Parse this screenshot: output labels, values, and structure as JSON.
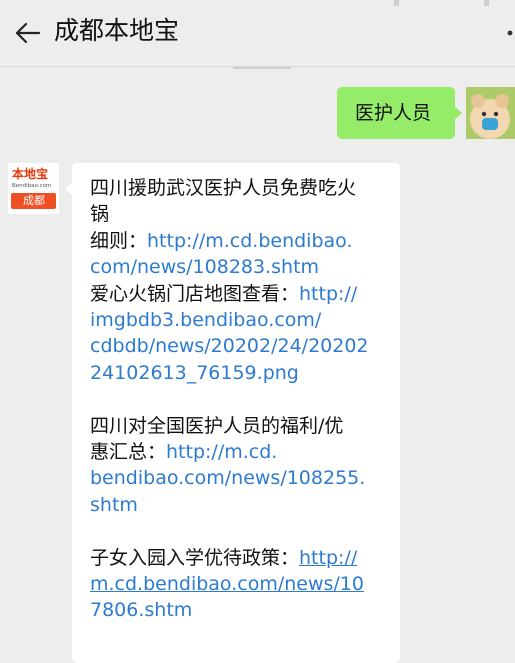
{
  "header": {
    "title": "成都本地宝"
  },
  "outgoing": {
    "text": "医护人员"
  },
  "incoming": {
    "avatar": {
      "logo_top": "本地宝",
      "logo_site": "Bendibao.com",
      "logo_city": "成都"
    },
    "lines": [
      "四川援助武汉医护人员免费吃火",
      "锅",
      "细则：",
      "http://m.cd.bendibao.",
      "com/news/108283.shtm",
      "爱心火锅门店地图查看：",
      "http://",
      "imgbdb3.bendibao.com/",
      "cdbdb/news/20202/24/20202",
      "24102613_76159.png",
      "四川对全国医护人员的福利/优",
      "惠汇总：",
      "http://m.cd.",
      "bendibao.com/news/108255.",
      "shtm",
      "子女入园入学优待政策：",
      "http://",
      "m.cd.bendibao.com/news/10",
      "7806.shtm"
    ]
  },
  "colors": {
    "background": "#ededed",
    "outgoing_bubble": "#95ec69",
    "incoming_bubble": "#ffffff",
    "link": "#2d7bd0"
  }
}
